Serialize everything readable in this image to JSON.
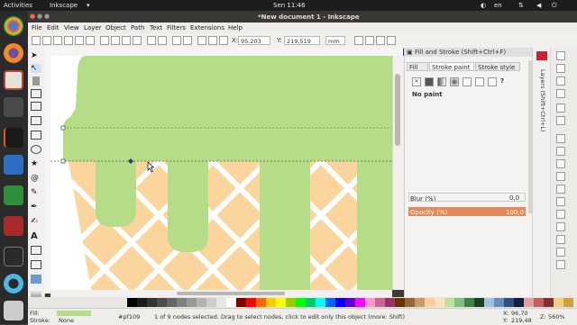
{
  "topbar": {
    "activities": "Activities",
    "app_name": "Inkscape",
    "clock": "Sen 11:46",
    "lang": "en"
  },
  "window": {
    "title": "*New document 1 - Inkscape"
  },
  "menu": [
    "File",
    "Edit",
    "View",
    "Layer",
    "Object",
    "Path",
    "Text",
    "Filters",
    "Extensions",
    "Help"
  ],
  "tool_controls": {
    "x_label": "X:",
    "x_value": "95,203",
    "y_label": "Y:",
    "y_value": "219,519",
    "unit": "mm"
  },
  "panel": {
    "header": "Fill and Stroke (Shift+Ctrl+F)",
    "tabs": [
      "Fill",
      "Stroke paint",
      "Stroke style"
    ],
    "paint_status": "No paint",
    "blur_label": "Blur (%)",
    "blur_value": "0,0",
    "opacity_label": "Opacity (%)",
    "opacity_value": "100,0",
    "side_label": "Layers (Shift+Ctrl+L)"
  },
  "status": {
    "fill_label": "Fill:",
    "stroke_label": "Stroke:",
    "stroke_value": "None",
    "color_code": "#pf109",
    "message": "1 of 9 nodes selected. Drag to select nodes, click to edit only this object (more: Shift)",
    "x_label": "X:",
    "x_value": "96,70",
    "y_label": "Y:",
    "y_value": "219,48",
    "z_label": "Z:",
    "zoom": "560%"
  },
  "colors": {
    "drip_green": "#b5dc86",
    "cone_orange": "#fad69e",
    "opacity_bar": "#e08a5a"
  },
  "palette_colors": [
    "#000000",
    "#1a1a1a",
    "#333333",
    "#4d4d4d",
    "#666666",
    "#808080",
    "#999999",
    "#b3b3b3",
    "#cccccc",
    "#e6e6e6",
    "#ffffff",
    "#800000",
    "#ff0000",
    "#ff6600",
    "#ffcc00",
    "#ffff00",
    "#99cc00",
    "#00ff00",
    "#00cc66",
    "#00ffff",
    "#0066ff",
    "#0000ff",
    "#6600cc",
    "#ff00ff",
    "#ff99cc",
    "#cc6699",
    "#993366",
    "#663300",
    "#996633",
    "#cc9966",
    "#ffcc99",
    "#ffe0c0",
    "#c0e0a0",
    "#80c080",
    "#408040",
    "#204020",
    "#a0c0e0",
    "#6090c0",
    "#305080",
    "#102040",
    "#e0a0a0",
    "#c06060",
    "#803030",
    "#f0d080",
    "#d0a040"
  ]
}
